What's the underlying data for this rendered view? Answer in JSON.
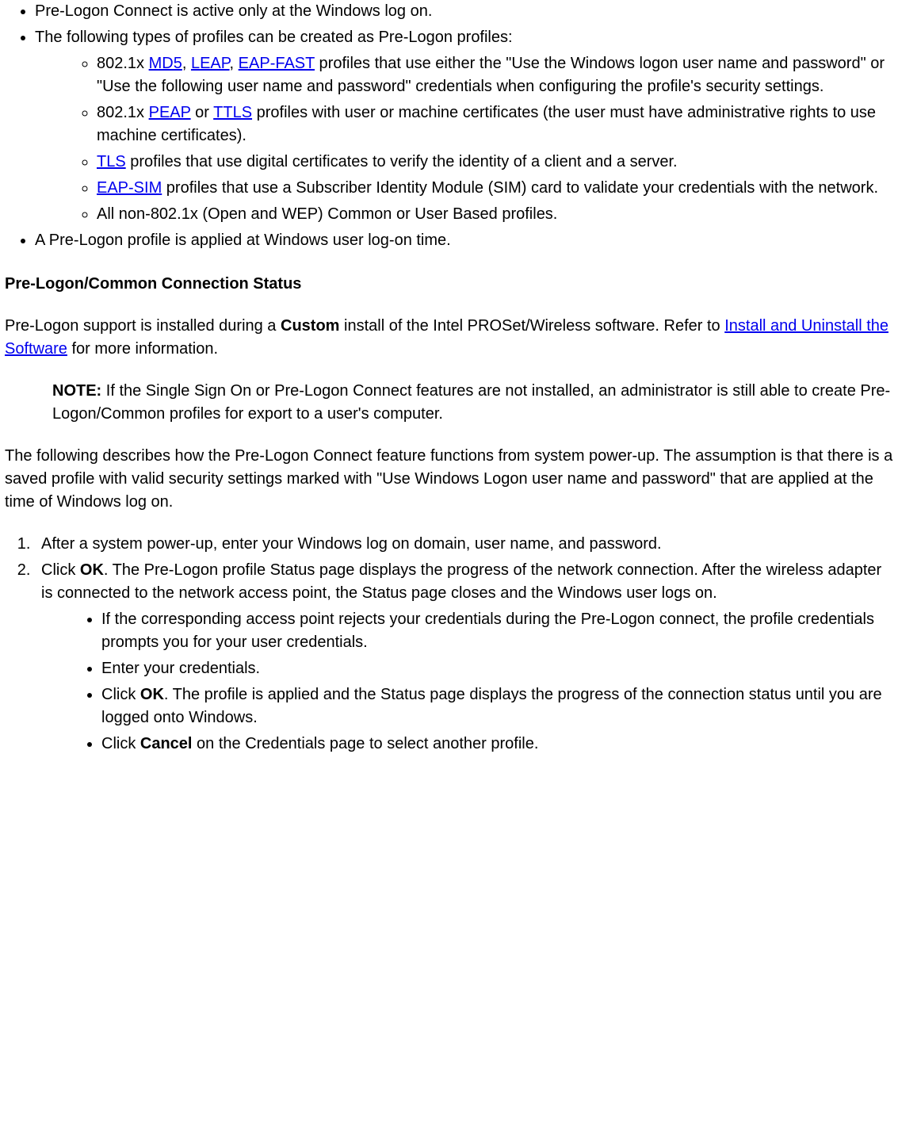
{
  "top_list": {
    "item1": "Pre-Logon Connect is active only at the Windows log on.",
    "item2": "The following types of profiles can be created as Pre-Logon profiles:",
    "sub": {
      "s1_a": "802.1x ",
      "md5": "MD5",
      "s1_b": ", ",
      "leap": "LEAP",
      "s1_c": ", ",
      "eapfast": "EAP-FAST",
      "s1_d": " profiles that use either the \"Use the Windows logon user name and password\" or \"Use the following user name and password\" credentials when configuring the profile's security settings.",
      "s2_a": "802.1x ",
      "peap": "PEAP",
      "s2_b": " or ",
      "ttls": "TTLS",
      "s2_c": " profiles with user or machine certificates (the user must have administrative rights to use machine certificates).",
      "tls": "TLS",
      "s3_b": " profiles that use digital certificates to verify the identity of a client and a server.",
      "eapsim": "EAP-SIM",
      "s4_b": " profiles that use a Subscriber Identity Module (SIM) card to validate your credentials with the network.",
      "s5": "All non-802.1x (Open and WEP) Common or User Based profiles."
    },
    "item3": "A Pre-Logon profile is applied at Windows user log-on time."
  },
  "heading": "Pre-Logon/Common Connection Status",
  "para1_a": "Pre-Logon support is installed during a ",
  "para1_custom": "Custom",
  "para1_b": " install of the Intel PROSet/Wireless software. Refer to ",
  "para1_link": "Install and Uninstall the Software",
  "para1_c": " for more information.",
  "note_label": "NOTE:",
  "note_text": " If the Single Sign On or Pre-Logon Connect features are not installed, an administrator is still able to create Pre-Logon/Common profiles for export to a user's computer.",
  "para2": "The following describes how the Pre-Logon Connect feature functions from system power-up. The assumption is that there is a saved profile with valid security settings marked with \"Use Windows Logon user name and password\" that are applied at the time of Windows log on.",
  "steps": {
    "s1": "After a system power-up, enter your Windows log on domain, user name, and password.",
    "s2_a": "Click ",
    "s2_ok": "OK",
    "s2_b": ". The Pre-Logon profile Status page displays the progress of the network connection. After the wireless adapter is connected to the network access point, the Status page closes and the Windows user logs on.",
    "sub1": "If the corresponding access point rejects your credentials during the Pre-Logon connect, the profile credentials prompts you for your user credentials.",
    "sub2": "Enter your credentials.",
    "sub3_a": "Click ",
    "sub3_ok": "OK",
    "sub3_b": ". The profile is applied and the Status page displays the progress of the connection status until you are logged onto Windows.",
    "sub4_a": "Click ",
    "sub4_cancel": "Cancel",
    "sub4_b": " on the Credentials page to select another profile."
  }
}
